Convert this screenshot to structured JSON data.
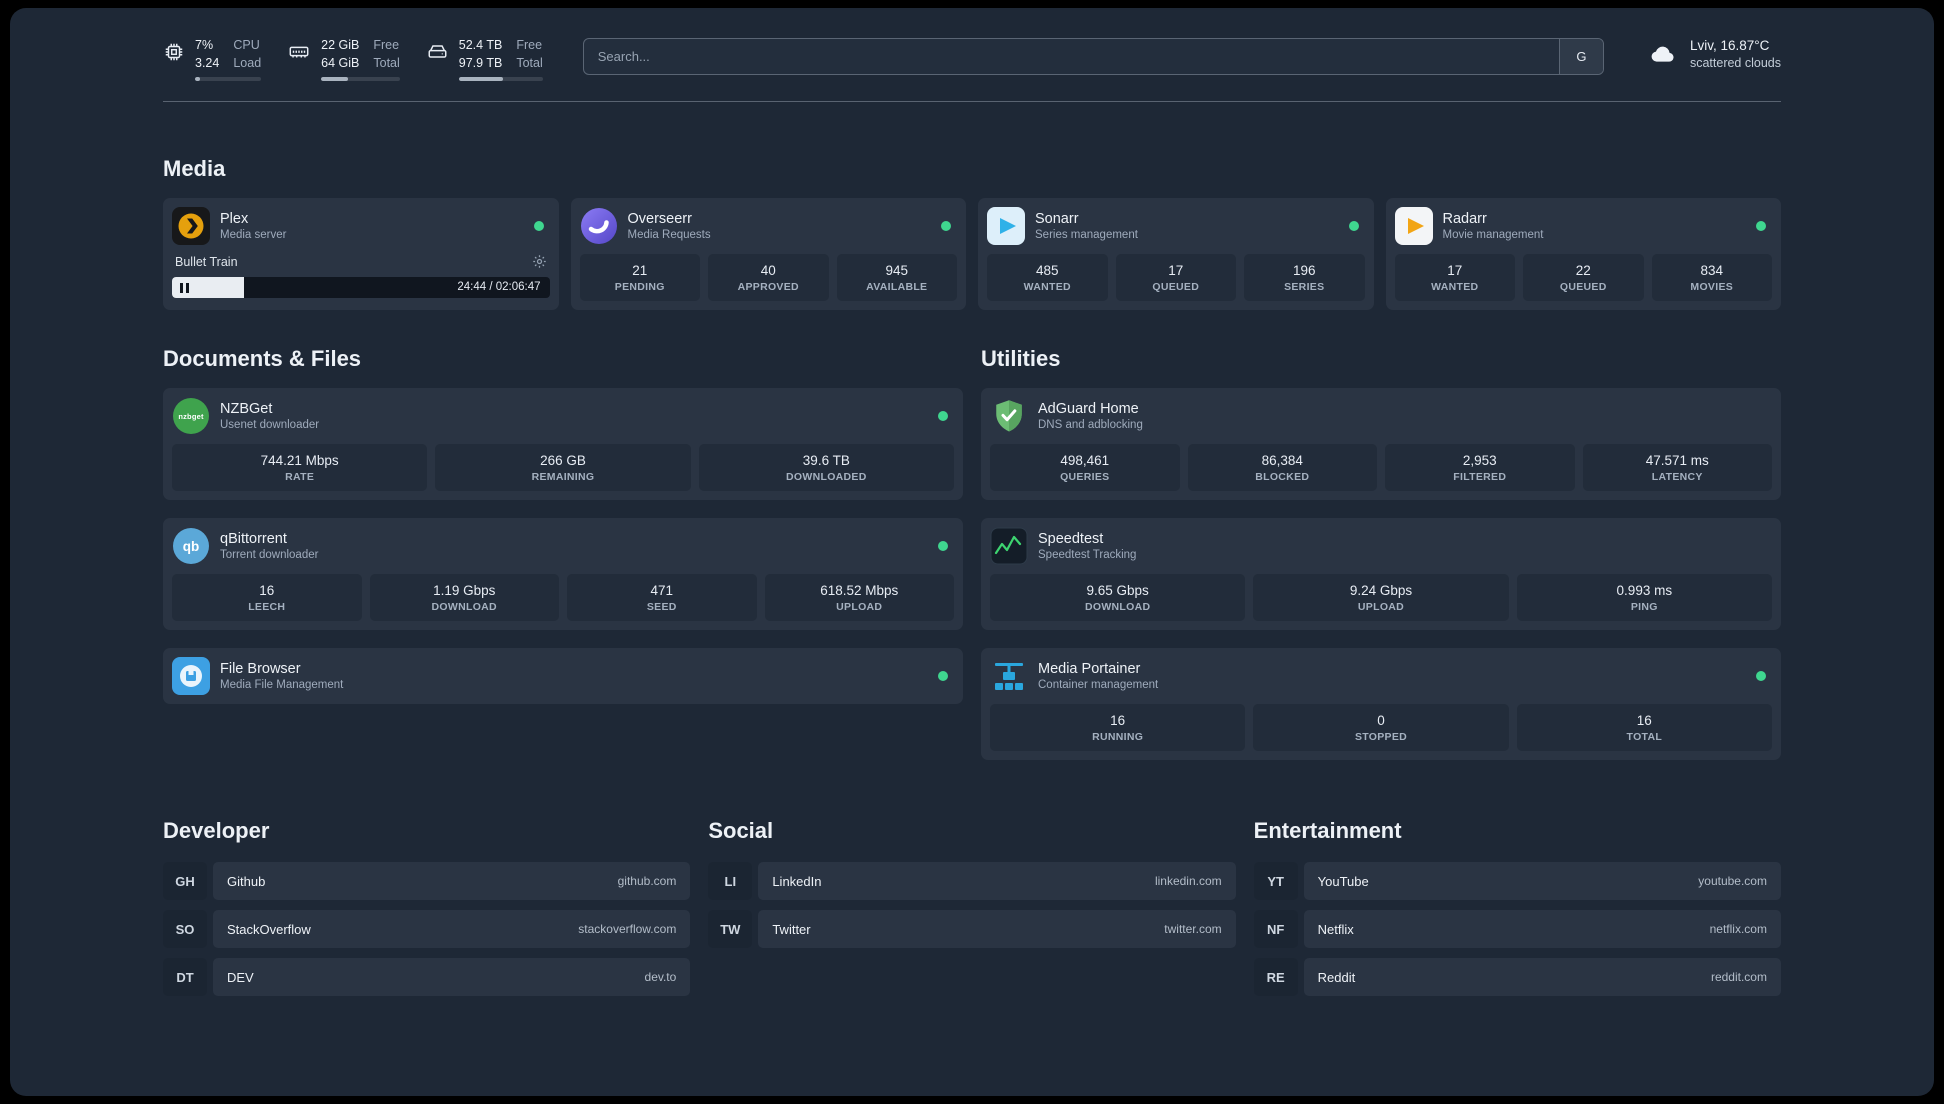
{
  "topbar": {
    "cpu": {
      "line1": "7%",
      "line2": "3.24",
      "label1": "CPU",
      "label2": "Load",
      "progress": 8
    },
    "memory": {
      "line1": "22 GiB",
      "line2": "64 GiB",
      "label1": "Free",
      "label2": "Total",
      "progress": 34
    },
    "disk": {
      "line1": "52.4 TB",
      "line2": "97.9 TB",
      "label1": "Free",
      "label2": "Total",
      "progress": 53
    },
    "search": {
      "placeholder": "Search...",
      "button_label": "G"
    },
    "weather": {
      "location": "Lviv, 16.87°C",
      "condition": "scattered clouds"
    }
  },
  "icons": {
    "nzbget_label": "nzbget",
    "qbittorrent_label": "qb"
  },
  "sections": {
    "media": {
      "title": "Media",
      "plex": {
        "name": "Plex",
        "subtitle": "Media server",
        "now_playing": "Bullet Train",
        "time": "24:44 / 02:06:47",
        "progress": 19
      },
      "overseerr": {
        "name": "Overseerr",
        "subtitle": "Media Requests",
        "stats": [
          {
            "value": "21",
            "label": "PENDING"
          },
          {
            "value": "40",
            "label": "APPROVED"
          },
          {
            "value": "945",
            "label": "AVAILABLE"
          }
        ]
      },
      "sonarr": {
        "name": "Sonarr",
        "subtitle": "Series management",
        "stats": [
          {
            "value": "485",
            "label": "WANTED"
          },
          {
            "value": "17",
            "label": "QUEUED"
          },
          {
            "value": "196",
            "label": "SERIES"
          }
        ]
      },
      "radarr": {
        "name": "Radarr",
        "subtitle": "Movie management",
        "stats": [
          {
            "value": "17",
            "label": "WANTED"
          },
          {
            "value": "22",
            "label": "QUEUED"
          },
          {
            "value": "834",
            "label": "MOVIES"
          }
        ]
      }
    },
    "documents": {
      "title": "Documents & Files",
      "nzbget": {
        "name": "NZBGet",
        "subtitle": "Usenet downloader",
        "stats": [
          {
            "value": "744.21 Mbps",
            "label": "RATE"
          },
          {
            "value": "266 GB",
            "label": "REMAINING"
          },
          {
            "value": "39.6 TB",
            "label": "DOWNLOADED"
          }
        ]
      },
      "qbittorrent": {
        "name": "qBittorrent",
        "subtitle": "Torrent downloader",
        "stats": [
          {
            "value": "16",
            "label": "LEECH"
          },
          {
            "value": "1.19 Gbps",
            "label": "DOWNLOAD"
          },
          {
            "value": "471",
            "label": "SEED"
          },
          {
            "value": "618.52 Mbps",
            "label": "UPLOAD"
          }
        ]
      },
      "filebrowser": {
        "name": "File Browser",
        "subtitle": "Media File Management"
      }
    },
    "utilities": {
      "title": "Utilities",
      "adguard": {
        "name": "AdGuard Home",
        "subtitle": "DNS and adblocking",
        "stats": [
          {
            "value": "498,461",
            "label": "QUERIES"
          },
          {
            "value": "86,384",
            "label": "BLOCKED"
          },
          {
            "value": "2,953",
            "label": "FILTERED"
          },
          {
            "value": "47.571 ms",
            "label": "LATENCY"
          }
        ]
      },
      "speedtest": {
        "name": "Speedtest",
        "subtitle": "Speedtest Tracking",
        "stats": [
          {
            "value": "9.65 Gbps",
            "label": "DOWNLOAD"
          },
          {
            "value": "9.24 Gbps",
            "label": "UPLOAD"
          },
          {
            "value": "0.993 ms",
            "label": "PING"
          }
        ]
      },
      "portainer": {
        "name": "Media Portainer",
        "subtitle": "Container management",
        "stats": [
          {
            "value": "16",
            "label": "RUNNING"
          },
          {
            "value": "0",
            "label": "STOPPED"
          },
          {
            "value": "16",
            "label": "TOTAL"
          }
        ]
      }
    },
    "developer": {
      "title": "Developer",
      "links": [
        {
          "abbr": "GH",
          "name": "Github",
          "url": "github.com"
        },
        {
          "abbr": "SO",
          "name": "StackOverflow",
          "url": "stackoverflow.com"
        },
        {
          "abbr": "DT",
          "name": "DEV",
          "url": "dev.to"
        }
      ]
    },
    "social": {
      "title": "Social",
      "links": [
        {
          "abbr": "LI",
          "name": "LinkedIn",
          "url": "linkedin.com"
        },
        {
          "abbr": "TW",
          "name": "Twitter",
          "url": "twitter.com"
        }
      ]
    },
    "entertainment": {
      "title": "Entertainment",
      "links": [
        {
          "abbr": "YT",
          "name": "YouTube",
          "url": "youtube.com"
        },
        {
          "abbr": "NF",
          "name": "Netflix",
          "url": "netflix.com"
        },
        {
          "abbr": "RE",
          "name": "Reddit",
          "url": "reddit.com"
        }
      ]
    }
  }
}
